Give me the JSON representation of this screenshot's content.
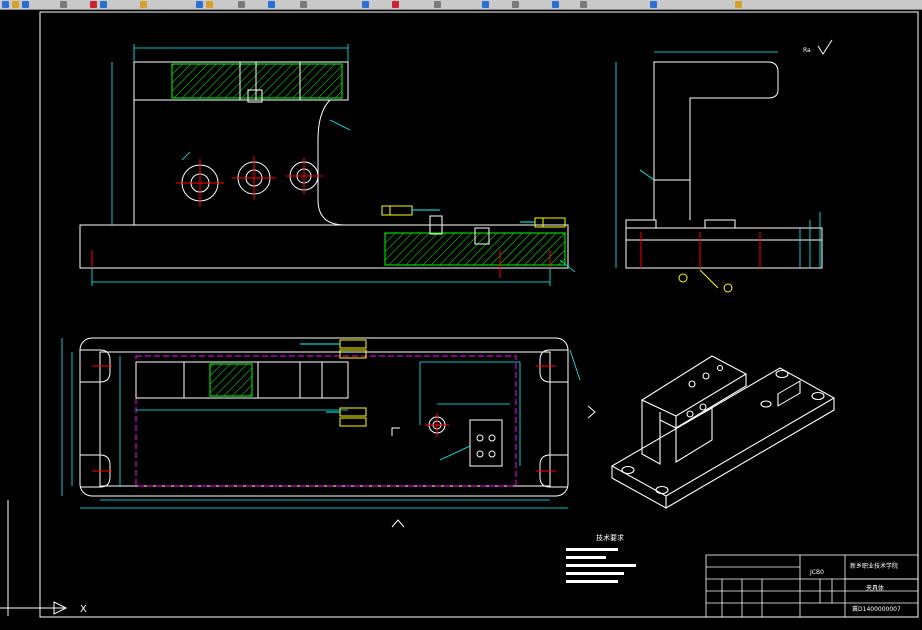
{
  "toolbar": {
    "right_label": "",
    "icons": [
      "layer-icon",
      "color-icon",
      "linetype-icon",
      "lineweight-icon",
      "properties-icon",
      "matchprop-icon",
      "zoom-icon",
      "pan-icon",
      "table-icon",
      "calc-icon",
      "block-icon",
      "save-icon",
      "print-icon",
      "preview-icon",
      "undo-icon",
      "redo-icon",
      "copy-icon",
      "paste-icon",
      "dist-icon",
      "area-icon",
      "help-icon"
    ]
  },
  "annotations": {
    "tech_req_title": "技术要求",
    "surface_note": "Ra",
    "ucs_label_x": "X"
  },
  "title_block": {
    "part_code": "JCB0",
    "college": "新乡职业技术学院",
    "part_name": "夹具体",
    "drawing_no": "冀D1400000007"
  },
  "colors": {
    "outline": "#ffffff",
    "dimension": "#00ffff",
    "hatch": "#00ff00",
    "center": "#ff0000",
    "hidden": "#ff00ff",
    "note": "#ffff00"
  }
}
